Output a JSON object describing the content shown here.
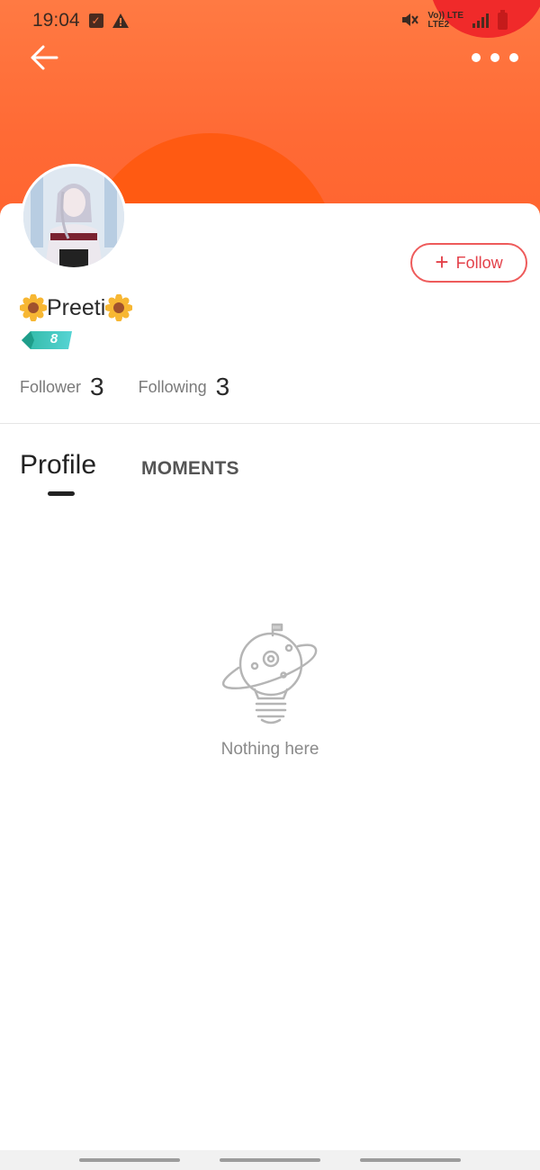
{
  "status_bar": {
    "time": "19:04",
    "network_line1": "Vo)) LTE",
    "network_line2": "LTE2",
    "icons": [
      "checkbox-notification-icon",
      "warning-icon",
      "mute-icon",
      "signal-icon",
      "battery-icon"
    ]
  },
  "colors": {
    "header_orange": "#ff7043",
    "sun": "#ff5a12",
    "accent_red": "#e3414a",
    "level_teal": "#3ec6b6"
  },
  "top_nav": {
    "back_icon": "back-arrow-icon",
    "more_icon": "more-dots-icon"
  },
  "profile": {
    "name": "Preeti",
    "name_prefix_icon": "sunflower-emoji-icon",
    "name_suffix_icon": "sunflower-emoji-icon",
    "level": "8",
    "follow_label": "Follow",
    "follower_label": "Follower",
    "follower_count": "3",
    "following_label": "Following",
    "following_count": "3"
  },
  "tabs": [
    {
      "label": "Profile",
      "active": true
    },
    {
      "label": "MOMENTS",
      "active": false
    }
  ],
  "empty_state": {
    "icon": "planet-lightbulb-icon",
    "text": "Nothing here"
  }
}
